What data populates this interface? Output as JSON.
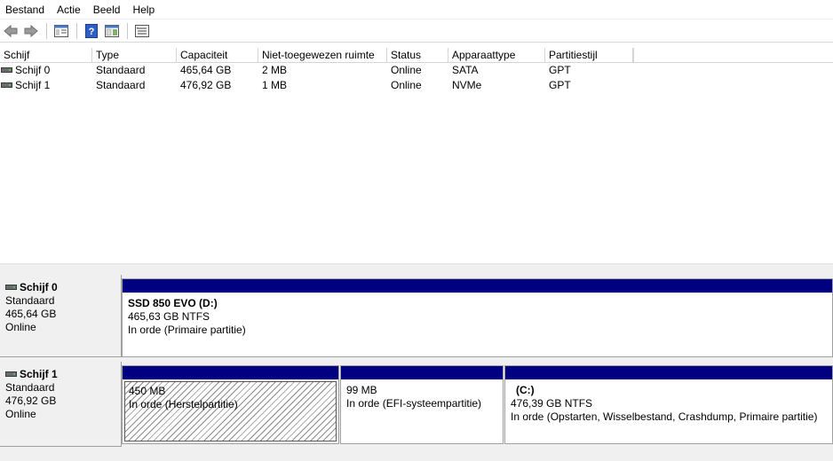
{
  "menu": [
    "Bestand",
    "Actie",
    "Beeld",
    "Help"
  ],
  "toolbar": {
    "icons": [
      "back-arrow-icon",
      "forward-arrow-icon",
      "console-tree-icon",
      "help-icon",
      "properties-icon",
      "list-view-icon"
    ]
  },
  "list": {
    "columns": [
      "Schijf",
      "Type",
      "Capaciteit",
      "Niet-toegewezen ruimte",
      "Status",
      "Apparaattype",
      "Partitiestijl"
    ],
    "rows": [
      [
        "Schijf 0",
        "Standaard",
        "465,64 GB",
        "2 MB",
        "Online",
        "SATA",
        "GPT"
      ],
      [
        "Schijf 1",
        "Standaard",
        "476,92 GB",
        "1 MB",
        "Online",
        "NVMe",
        "GPT"
      ]
    ]
  },
  "disks": [
    {
      "name": "Schijf 0",
      "type": "Standaard",
      "size": "465,64 GB",
      "status": "Online",
      "partitions": [
        {
          "title": "SSD 850 EVO  (D:)",
          "size": "465,63 GB NTFS",
          "status": "In orde (Primaire partitie)",
          "hatched": false
        }
      ]
    },
    {
      "name": "Schijf 1",
      "type": "Standaard",
      "size": "476,92 GB",
      "status": "Online",
      "partitions": [
        {
          "title": "",
          "size": "450 MB",
          "status": "In orde (Herstelpartitie)",
          "hatched": true
        },
        {
          "title": "",
          "size": "99 MB",
          "status": "In orde (EFI-systeempartitie)",
          "hatched": false
        },
        {
          "title": "(C:)",
          "size": "476,39 GB NTFS",
          "status": "In orde (Opstarten, Wisselbestand, Crashdump, Primaire partitie)",
          "hatched": false
        }
      ]
    }
  ],
  "colors": {
    "partition_bar": "#000080",
    "panel_bg": "#f0f0f0"
  }
}
